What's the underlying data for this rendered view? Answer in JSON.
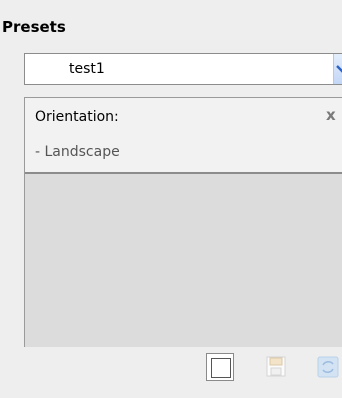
{
  "presets": {
    "title": "Presets",
    "selected_value": "test1"
  },
  "panel": {
    "label": "Orientation:",
    "close_symbol": "x",
    "items": [
      "- Landscape"
    ]
  },
  "toolbar": {
    "buttons": [
      {
        "icon": "new-preset-icon"
      },
      {
        "icon": "save-icon"
      },
      {
        "icon": "refresh-icon"
      }
    ]
  },
  "colors": {
    "background": "#eeeeee",
    "panel_fill": "#dcdcdc",
    "dropdown_accent": "#c3d6f6",
    "dropdown_chevron": "#2c63c4"
  }
}
